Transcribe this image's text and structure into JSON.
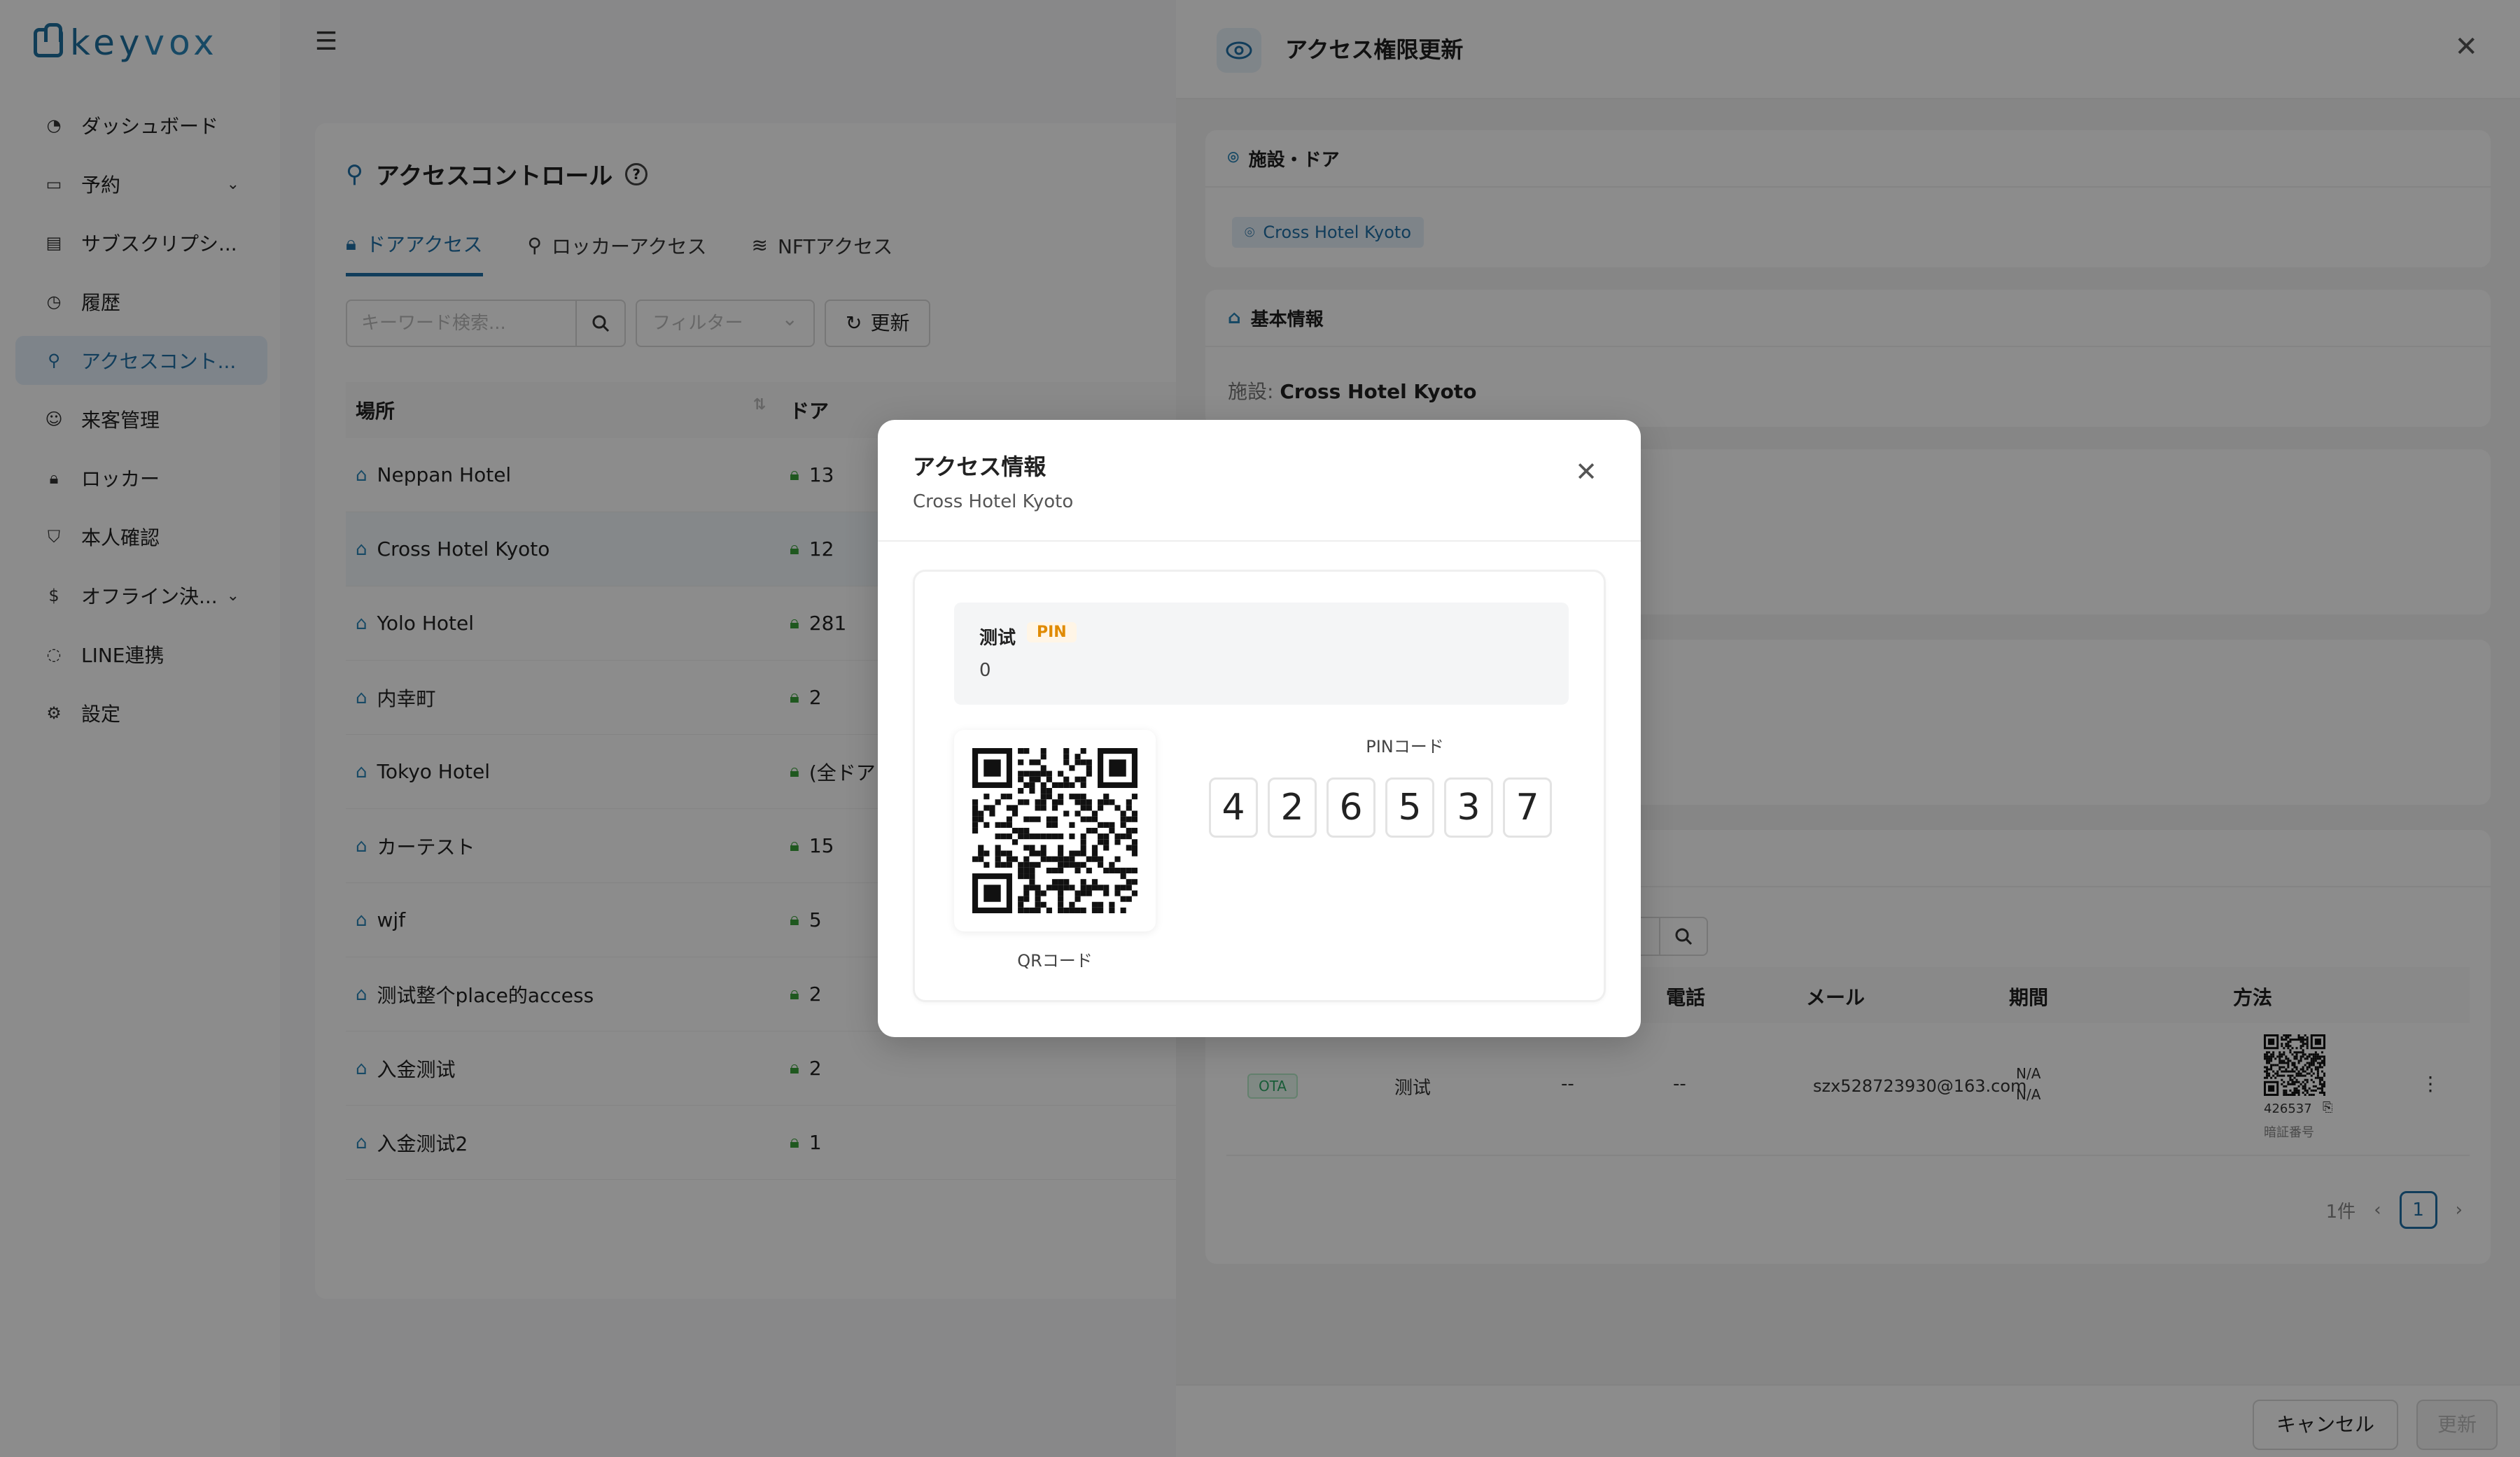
{
  "app": {
    "logo_a": "key",
    "logo_b": "vox"
  },
  "sidebar": {
    "items": [
      {
        "label": "ダッシュボード",
        "icon": "dashboard-icon"
      },
      {
        "label": "予約",
        "icon": "calendar-icon",
        "has_children": true
      },
      {
        "label": "サブスクリプシ...",
        "icon": "card-icon"
      },
      {
        "label": "履歴",
        "icon": "history-icon"
      },
      {
        "label": "アクセスコント...",
        "icon": "search-icon",
        "active": true
      },
      {
        "label": "来客管理",
        "icon": "visitor-icon"
      },
      {
        "label": "ロッカー",
        "icon": "lock-icon"
      },
      {
        "label": "本人確認",
        "icon": "shield-icon"
      },
      {
        "label": "オフライン決...",
        "icon": "dollar-icon",
        "has_children": true
      },
      {
        "label": "LINE連携",
        "icon": "chat-icon"
      },
      {
        "label": "設定",
        "icon": "gear-icon"
      }
    ]
  },
  "main": {
    "title": "アクセスコントロール",
    "tabs": [
      "ドアアクセス",
      "ロッカーアクセス",
      "NFTアクセス"
    ],
    "search_placeholder": "キーワード検索...",
    "filter_placeholder": "フィルター",
    "refresh_label": "更新",
    "columns": [
      "場所",
      "ドア"
    ],
    "rows": [
      {
        "place": "Neppan Hotel",
        "door": "13"
      },
      {
        "place": "Cross Hotel Kyoto",
        "door": "12"
      },
      {
        "place": "Yolo Hotel",
        "door": "281"
      },
      {
        "place": "内幸町",
        "door": "2"
      },
      {
        "place": "Tokyo Hotel",
        "door": "(全ドア"
      },
      {
        "place": "カーテスト",
        "door": "15"
      },
      {
        "place": "wjf",
        "door": "5"
      },
      {
        "place": "测试整个place的access",
        "door": "2"
      },
      {
        "place": "入金测试",
        "door": "2"
      },
      {
        "place": "入金测试2",
        "door": "1"
      }
    ]
  },
  "drawer": {
    "title": "アクセス権限更新",
    "section_facility_door": "施設・ドア",
    "facility_tag": "Cross Hotel Kyoto",
    "section_basic": "基本情報",
    "facility_label": "施設:",
    "facility_value": "Cross Hotel Kyoto",
    "guest_table": {
      "columns": [
        "電話",
        "メール",
        "期間",
        "方法"
      ],
      "row": {
        "badge": "OTA",
        "name": "测试",
        "col_a": "--",
        "phone": "--",
        "email": "szx528723930@163.com",
        "period_1": "N/A",
        "period_2": "N/A",
        "code": "426537",
        "code_label": "暗証番号"
      }
    },
    "pager": {
      "total": "1件",
      "page": "1"
    },
    "cancel_label": "キャンセル",
    "update_label": "更新"
  },
  "modal": {
    "title": "アクセス情報",
    "subtitle": "Cross Hotel Kyoto",
    "guest_name": "测试",
    "badge": "PIN",
    "guest_value": "0",
    "qr_label": "QRコード",
    "pin_label": "PINコード",
    "pin_digits": [
      "4",
      "2",
      "6",
      "5",
      "3",
      "7"
    ]
  }
}
